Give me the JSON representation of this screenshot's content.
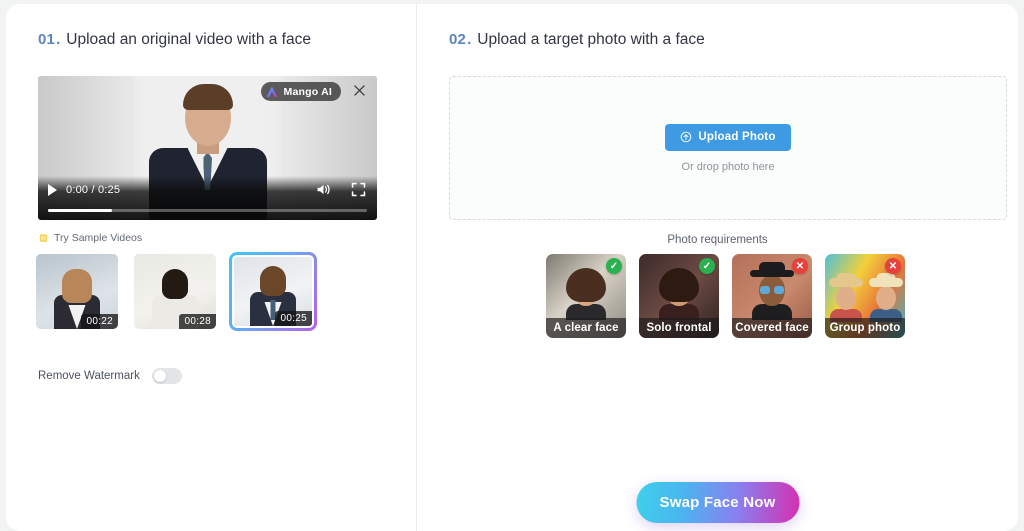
{
  "steps": {
    "left": {
      "number": "01",
      "dot": ".",
      "title": "Upload an original video with a face"
    },
    "right": {
      "number": "02",
      "dot": ".",
      "title": "Upload a target photo with a face"
    }
  },
  "video": {
    "watermark_badge": "Mango AI",
    "watermark_logo_icon": "mango-logo-icon",
    "close_icon": "close-icon",
    "play_icon": "play-icon",
    "time": "0:00 / 0:25",
    "volume_icon": "volume-icon",
    "fullscreen_icon": "fullscreen-icon",
    "progress_percent": 20
  },
  "samples": {
    "icon": "lightbulb-icon",
    "label": "Try Sample Videos",
    "items": [
      {
        "duration": "00:22",
        "selected": false,
        "alt": "woman-in-blazer-thumbnail"
      },
      {
        "duration": "00:28",
        "selected": false,
        "alt": "man-in-white-shirt-thumbnail"
      },
      {
        "duration": "00:25",
        "selected": true,
        "alt": "man-in-suit-thumbnail"
      }
    ]
  },
  "watermark_toggle": {
    "label": "Remove Watermark",
    "enabled": false
  },
  "dropzone": {
    "button_label": "Upload Photo",
    "button_icon": "cloud-upload-icon",
    "hint": "Or drop photo here"
  },
  "requirements": {
    "title": "Photo requirements",
    "cards": [
      {
        "label": "A clear face",
        "status": "ok",
        "badge": "✓"
      },
      {
        "label": "Solo frontal",
        "status": "ok",
        "badge": "✓"
      },
      {
        "label": "Covered face",
        "status": "bad",
        "badge": "✕"
      },
      {
        "label": "Group photo",
        "status": "bad",
        "badge": "✕"
      }
    ]
  },
  "cta": {
    "label": "Swap Face Now"
  },
  "colors": {
    "step_number": "#5b84c4",
    "upload_button": "#3e9ae2",
    "badge_ok": "#2bb14f",
    "badge_bad": "#e8413c",
    "cta_gradient_start": "#3fd0ea",
    "cta_gradient_end": "#d62fb0"
  }
}
